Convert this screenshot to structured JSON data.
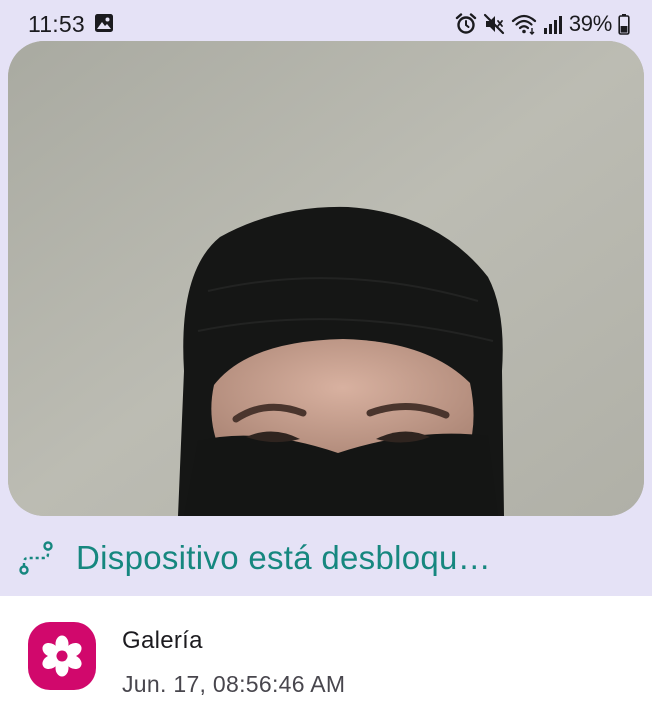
{
  "status_bar": {
    "time": "11:53",
    "battery_percent": "39%",
    "left_icons": [
      "image-icon"
    ],
    "right_icons": [
      "alarm-icon",
      "muted-icon",
      "wifi-icon",
      "signal-icon",
      "battery-icon"
    ]
  },
  "photo": {
    "subject": "person-in-black-balaclava"
  },
  "unlock_status": {
    "icon": "route-icon",
    "text": "Dispositivo está desbloqu…",
    "color": "#16877f"
  },
  "notification": {
    "app_icon": "flower-icon",
    "app_name": "Galería",
    "timestamp": "Jun. 17, 08:56:46 AM",
    "accent_color": "#d1086c"
  },
  "colors": {
    "background": "#e5e2f6",
    "card": "#ffffff"
  }
}
